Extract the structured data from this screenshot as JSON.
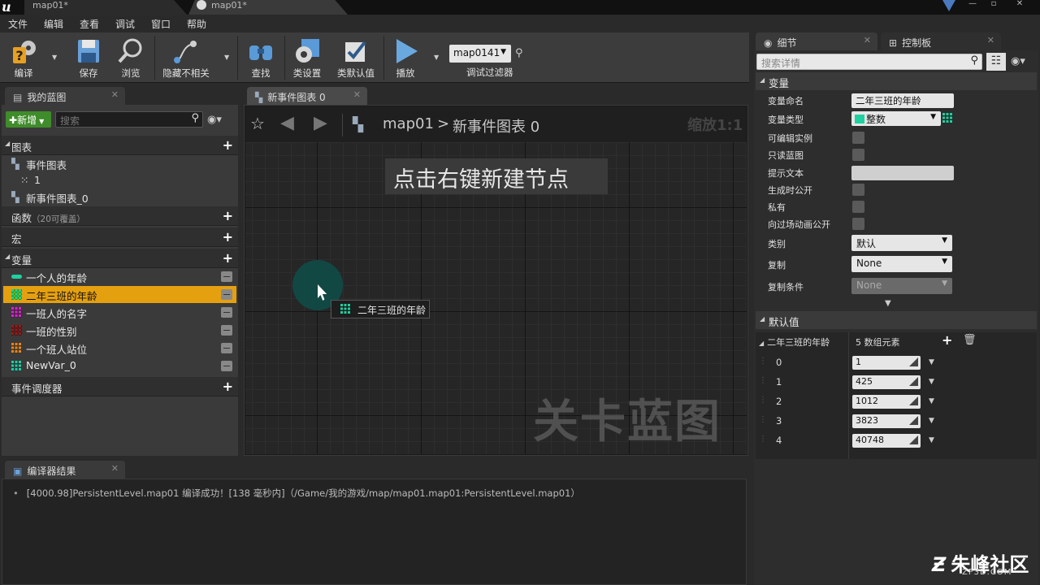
{
  "titlebar": {
    "tabs": [
      "map01*",
      "map01*"
    ]
  },
  "menu": [
    "文件",
    "编辑",
    "查看",
    "调试",
    "窗口",
    "帮助"
  ],
  "toolbar": {
    "buttons": [
      {
        "label": "编译",
        "icon": "compile-icon"
      },
      {
        "label": "保存",
        "icon": "save-icon"
      },
      {
        "label": "浏览",
        "icon": "browse-icon"
      },
      {
        "label": "隐藏不相关",
        "icon": "hide-unrelated-icon"
      },
      {
        "label": "查找",
        "icon": "find-icon"
      },
      {
        "label": "类设置",
        "icon": "class-settings-icon"
      },
      {
        "label": "类默认值",
        "icon": "class-defaults-icon"
      },
      {
        "label": "播放",
        "icon": "play-icon"
      }
    ],
    "debug_object": "map0141",
    "debug_filter_label": "调试过滤器"
  },
  "my_blueprint": {
    "tab_label": "我的蓝图",
    "new_label": "新增",
    "search_placeholder": "搜索",
    "graphs_label": "图表",
    "event_graph": "事件图表",
    "event_graph_child": "1",
    "new_event_graph": "新事件图表_0",
    "functions_label": "函数",
    "functions_note": "（20可覆盖）",
    "macros_label": "宏",
    "variables_label": "变量",
    "variables": [
      {
        "name": "一个人的年龄",
        "color": "#1fd0a0",
        "kind": "single",
        "selected": false
      },
      {
        "name": "二年三班的年龄",
        "color": "#1fd0a0",
        "kind": "array",
        "selected": true
      },
      {
        "name": "一班人的名字",
        "color": "#e020d0",
        "kind": "array",
        "selected": false
      },
      {
        "name": "一班的性别",
        "color": "#a01818",
        "kind": "array",
        "selected": false
      },
      {
        "name": "一个班人站位",
        "color": "#f08020",
        "kind": "array",
        "selected": false
      },
      {
        "name": "NewVar_0",
        "color": "#1fd0a0",
        "kind": "array",
        "selected": false
      }
    ],
    "dispatchers_label": "事件调度器"
  },
  "graph": {
    "tab_label": "新事件图表 0",
    "breadcrumb_root": "map01",
    "breadcrumb_sep": ">",
    "breadcrumb_leaf": "新事件图表 0",
    "zoom": "缩放1:1",
    "hint": "点击右键新建节点",
    "watermark": "关卡蓝图",
    "drag_label": "二年三班的年龄"
  },
  "compiler": {
    "tab_label": "编译器结果",
    "log": "[4000.98]PersistentLevel.map01 编译成功！[138 毫秒内]（/Game/我的游戏/map/map01.map01:PersistentLevel.map01）"
  },
  "details": {
    "tab_details": "细节",
    "tab_palette": "控制板",
    "search_placeholder": "搜索详情",
    "variable_section": "变量",
    "props": {
      "name_label": "变量命名",
      "name_value": "二年三班的年龄",
      "type_label": "变量类型",
      "type_value": "整数",
      "editable_label": "可编辑实例",
      "readonly_label": "只读蓝图",
      "tooltip_label": "提示文本",
      "expose_spawn_label": "生成时公开",
      "private_label": "私有",
      "expose_cine_label": "向过场动画公开",
      "category_label": "类别",
      "category_value": "默认",
      "replication_label": "复制",
      "replication_value": "None",
      "repcond_label": "复制条件",
      "repcond_value": "None"
    },
    "defaults_section": "默认值",
    "array_name": "二年三班的年龄",
    "array_count": "5 数组元素",
    "array": [
      {
        "index": "0",
        "value": "1"
      },
      {
        "index": "1",
        "value": "425"
      },
      {
        "index": "2",
        "value": "1012"
      },
      {
        "index": "3",
        "value": "3823"
      },
      {
        "index": "4",
        "value": "40748"
      }
    ]
  },
  "branding": {
    "name": "朱峰社区",
    "url": "ZF3D.COM"
  }
}
